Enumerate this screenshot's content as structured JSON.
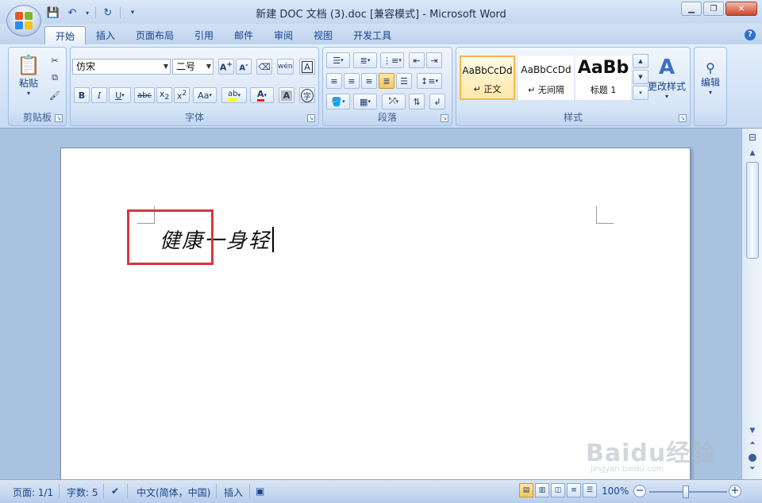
{
  "window": {
    "title": "新建 DOC 文档 (3).doc [兼容模式] - Microsoft Word"
  },
  "tabs": [
    "开始",
    "插入",
    "页面布局",
    "引用",
    "邮件",
    "审阅",
    "视图",
    "开发工具"
  ],
  "active_tab": "开始",
  "ribbon": {
    "clipboard": {
      "label": "剪贴板",
      "paste_label": "粘贴"
    },
    "font": {
      "label": "字体",
      "font_name": "仿宋",
      "font_size": "二号"
    },
    "paragraph": {
      "label": "段落"
    },
    "styles": {
      "label": "样式",
      "items": [
        {
          "preview": "AaBbCcDd",
          "name": "↵ 正文"
        },
        {
          "preview": "AaBbCcDd",
          "name": "↵ 无间隔"
        },
        {
          "preview": "AaBb",
          "name": "标题 1"
        }
      ],
      "change_styles_label": "更改样式"
    },
    "editing": {
      "label": "编辑"
    }
  },
  "document": {
    "text": "健康一身轻"
  },
  "status": {
    "page": "页面: 1/1",
    "word_count": "字数: 5",
    "language": "中文(简体，中国)",
    "mode": "插入",
    "zoom": "100%"
  },
  "watermark": {
    "logo": "Baidu经验",
    "url": "jingyan.baidu.com"
  },
  "colors": {
    "highlight_border": "#d9363a",
    "selected_style": "#f4b94a",
    "font_color": "#e02020",
    "highlight_color": "#ffff00"
  }
}
